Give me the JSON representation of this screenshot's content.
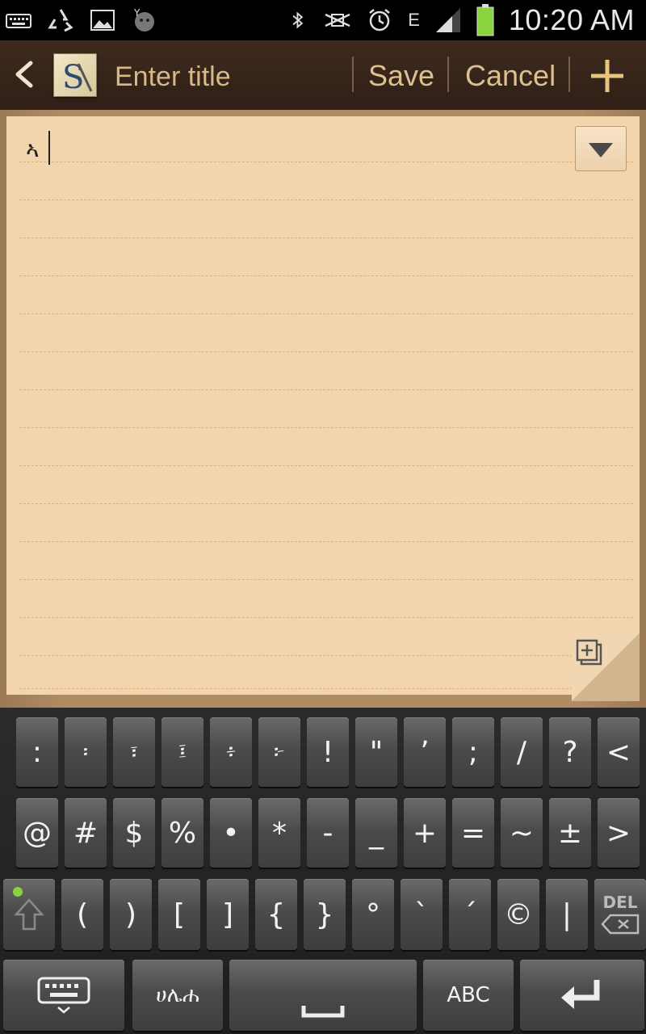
{
  "status_bar": {
    "time": "10:20 AM",
    "network": "E",
    "icons": [
      "keyboard-icon",
      "recycle-icon",
      "image-icon",
      "messenger-icon",
      "bluetooth-icon",
      "vibrate-icon",
      "alarm-icon",
      "signal-icon",
      "battery-icon"
    ],
    "battery_color": "#8bd23f"
  },
  "action_bar": {
    "title_placeholder": "Enter title",
    "save_label": "Save",
    "cancel_label": "Cancel",
    "logo_letter": "S"
  },
  "note": {
    "text": "ኣ"
  },
  "keyboard": {
    "row1": [
      ":",
      "፡",
      "፣",
      "፤",
      "፥",
      "፦",
      "!",
      "\"",
      "’",
      ";",
      "/",
      "?",
      "<"
    ],
    "row2": [
      "@",
      "#",
      "$",
      "%",
      "•",
      "*",
      "-",
      "_",
      "+",
      "=",
      "~",
      "±",
      ">"
    ],
    "row3": [
      "(",
      ")",
      "[",
      "]",
      "{",
      "}",
      "°",
      "`",
      "´",
      "©",
      "|"
    ],
    "del_label": "DEL",
    "lang_label": "ሀሌሐ",
    "abc_label": "ABC"
  },
  "colors": {
    "paper": "#f3d5ad",
    "action_bar": "#3f2b1f",
    "action_text": "#dcc090"
  }
}
